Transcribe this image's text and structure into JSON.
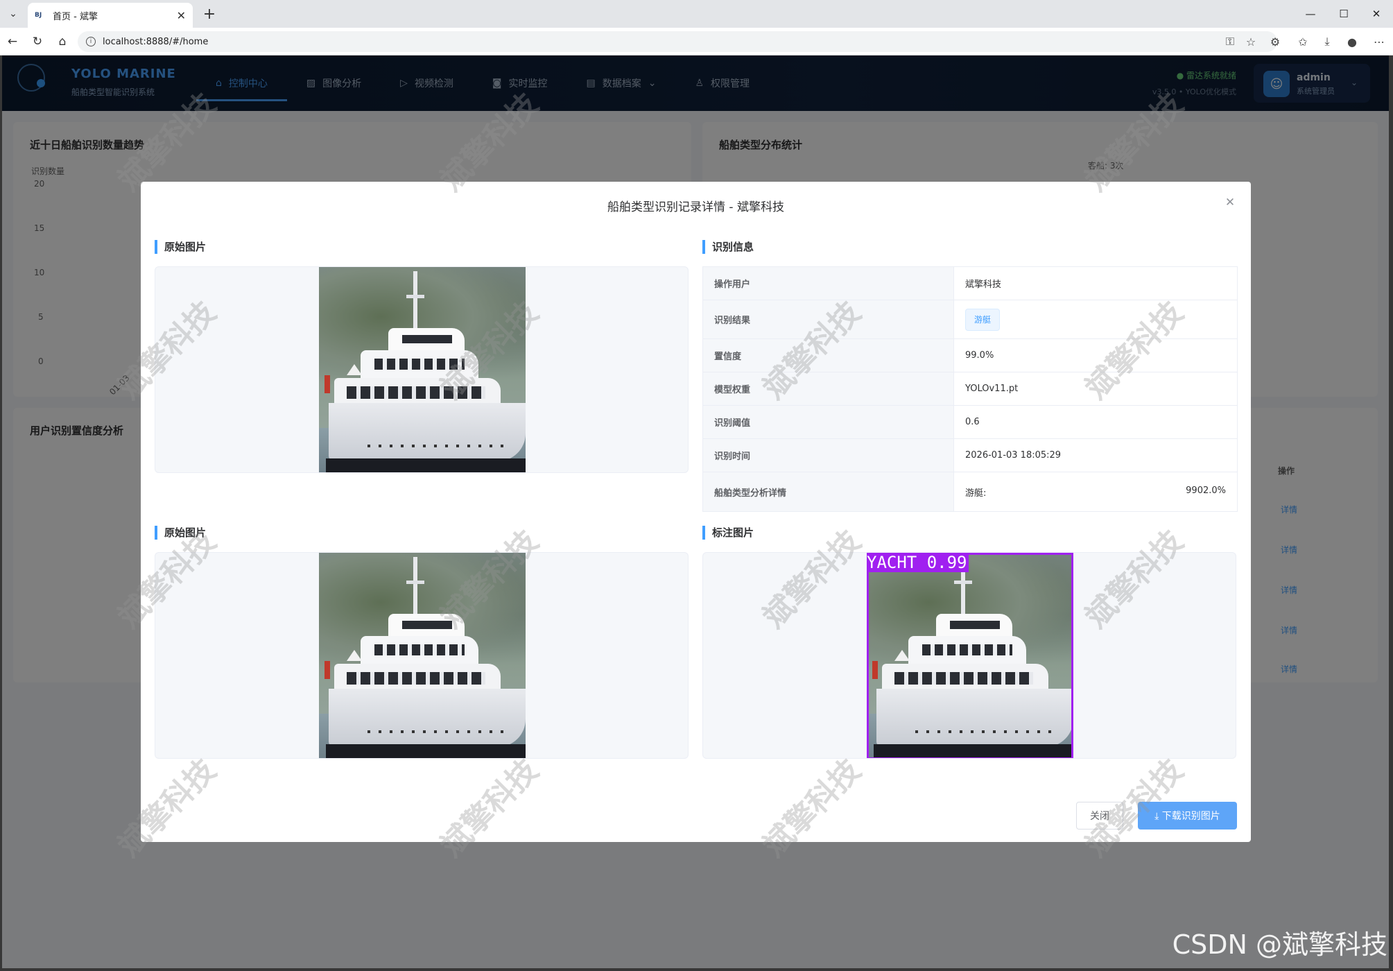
{
  "browser": {
    "tab_favicon": "BJ",
    "tab_title": "首页 - 斌擎",
    "url": "localhost:8888/#/home"
  },
  "app": {
    "brand": "YOLO MARINE",
    "brand_sub": "船舶类型智能识别系统",
    "nav": [
      {
        "label": "控制中心",
        "icon": "home-icon"
      },
      {
        "label": "图像分析",
        "icon": "image-icon"
      },
      {
        "label": "视频检测",
        "icon": "play-icon"
      },
      {
        "label": "实时监控",
        "icon": "camera-icon"
      },
      {
        "label": "数据档案",
        "icon": "document-icon"
      },
      {
        "label": "权限管理",
        "icon": "user-icon"
      }
    ],
    "status": "● 雷达系统就绪",
    "version": "v3.5.0 • YOLO优化模式",
    "user_name": "admin",
    "user_role": "系统管理员",
    "card_trend_title": "近十日船舶识别数量趋势",
    "trend_ylabel": "识别数量",
    "trend_ticks": [
      "20",
      "15",
      "10",
      "5",
      "0"
    ],
    "trend_xtick": "01-03",
    "card_type_title": "船舶类型分布统计",
    "pie_label": "客船: 3次",
    "card_conf_title": "用户识别置信度分析",
    "table_header_op": "操作",
    "detail_link": "详情"
  },
  "dialog": {
    "title": "船舶类型识别记录详情 - 斌擎科技",
    "section_original": "原始图片",
    "section_info": "识别信息",
    "section_original_2": "原始图片",
    "section_annotated": "标注图片",
    "detection_label": "YACHT  0.99",
    "info": {
      "user_key": "操作用户",
      "user_val": "斌擎科技",
      "result_key": "识别结果",
      "result_val": "游艇",
      "conf_key": "置信度",
      "conf_val": "99.0%",
      "model_key": "模型权重",
      "model_val": "YOLOv11.pt",
      "thresh_key": "识别阈值",
      "thresh_val": "0.6",
      "time_key": "识别时间",
      "time_val": "2026-01-03 18:05:29",
      "detail_key": "船舶类型分析详情",
      "detail_type": "游艇:",
      "detail_pct": "9902.0%"
    },
    "btn_close": "关闭",
    "btn_download": "⤓ 下载识别图片"
  },
  "watermark": "斌擎科技",
  "footer_mark": "CSDN @斌擎科技"
}
